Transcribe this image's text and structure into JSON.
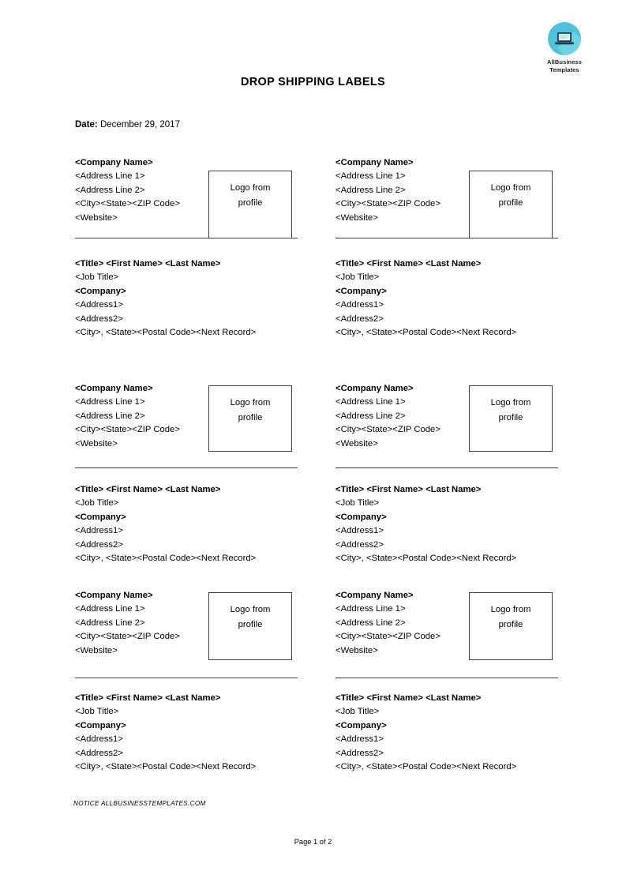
{
  "brand": {
    "name_line1": "AllBusiness",
    "name_line2": "Templates",
    "icon": "laptop-icon",
    "circle_color": "#4ec3d9",
    "shade_color": "#6fd3e3",
    "laptop_color": "#1f3a4d"
  },
  "document": {
    "title": "DROP SHIPPING LABELS",
    "date_label": "Date:",
    "date_value": "December 29, 2017"
  },
  "sender_block": {
    "line1": "<Company Name>",
    "line2": "<Address Line 1>",
    "line3": "<Address Line 2>",
    "line4": "<City><State><ZIP Code>",
    "line5": "<Website>",
    "logo_text_line1": "Logo from",
    "logo_text_line2": "profile"
  },
  "recipient_block": {
    "line1": "<Title> <First Name> <Last Name>",
    "line2": "<Job Title>",
    "line3": "<Company>",
    "line4": "<Address1>",
    "line5": "<Address2>",
    "line6": "<City>, <State><Postal Code><Next Record>"
  },
  "footer": {
    "notice": "NOTICE  ALLBUSINESSTEMPLATES.COM",
    "page": "Page 1 of 2"
  }
}
